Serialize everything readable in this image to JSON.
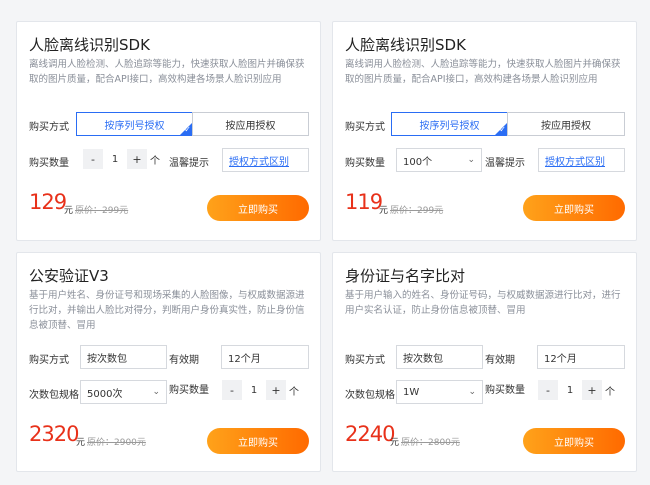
{
  "cards": [
    {
      "title": "人脸离线识别SDK",
      "description": "离线调用人脸检测、人脸追踪等能力，快速获取人脸图片并确保获取的图片质量，配合API接口，高效构建各场景人脸识别应用",
      "purchase_label": "购买方式",
      "options": [
        "按序列号授权",
        "按应用授权"
      ],
      "selected_option": "按序列号授权",
      "quantity_label": "购买数量",
      "quantity": "1",
      "quantity_unit": "个",
      "tips_label": "温馨提示",
      "tips_link": "授权方式区别",
      "price": "129",
      "currency": "元",
      "original_price": "原价：299元",
      "buy_label": "立即购买"
    },
    {
      "title": "人脸离线识别SDK",
      "description": "离线调用人脸检测、人脸追踪等能力，快速获取人脸图片并确保获取的图片质量，配合API接口，高效构建各场景人脸识别应用",
      "purchase_label": "购买方式",
      "options": [
        "按序列号授权",
        "按应用授权"
      ],
      "selected_option": "按序列号授权",
      "quantity_label": "购买数量",
      "quantity_select": "100个",
      "tips_label": "温馨提示",
      "tips_link": "授权方式区别",
      "price": "119",
      "currency": "元",
      "original_price": "原价：299元",
      "buy_label": "立即购买"
    },
    {
      "title": "公安验证V3",
      "description": "基于用户姓名、身份证号和现场采集的人脸图像，与权威数据源进行比对，并输出人脸比对得分，判断用户身份真实性，防止身份信息被顶替、冒用",
      "purchase_label": "购买方式",
      "purchase_value": "按次数包",
      "validity_label": "有效期",
      "validity_value": "12个月",
      "package_label": "次数包规格",
      "package_value": "5000次",
      "quantity_label": "购买数量",
      "quantity": "1",
      "quantity_unit": "个",
      "price": "2320",
      "currency": "元",
      "original_price": "原价：2900元",
      "buy_label": "立即购买"
    },
    {
      "title": "身份证与名字比对",
      "description": "基于用户输入的姓名、身份证号码，与权威数据源进行比对，进行用户实名认证，防止身份信息被顶替、冒用",
      "purchase_label": "购买方式",
      "purchase_value": "按次数包",
      "validity_label": "有效期",
      "validity_value": "12个月",
      "package_label": "次数包规格",
      "package_value": "1W",
      "quantity_label": "购买数量",
      "quantity": "1",
      "quantity_unit": "个",
      "price": "2240",
      "currency": "元",
      "original_price": "原价：2800元",
      "buy_label": "立即购买"
    }
  ],
  "stepper": {
    "minus": "-",
    "plus": "+"
  },
  "icons": {
    "select_arrow": "chevron-down-icon",
    "selected_corner": "check-corner-icon"
  },
  "colors": {
    "accent_blue": "#2a6df4",
    "price_red": "#e8311a",
    "button_orange_start": "#ffa21a",
    "button_orange_end": "#ff6a00"
  }
}
